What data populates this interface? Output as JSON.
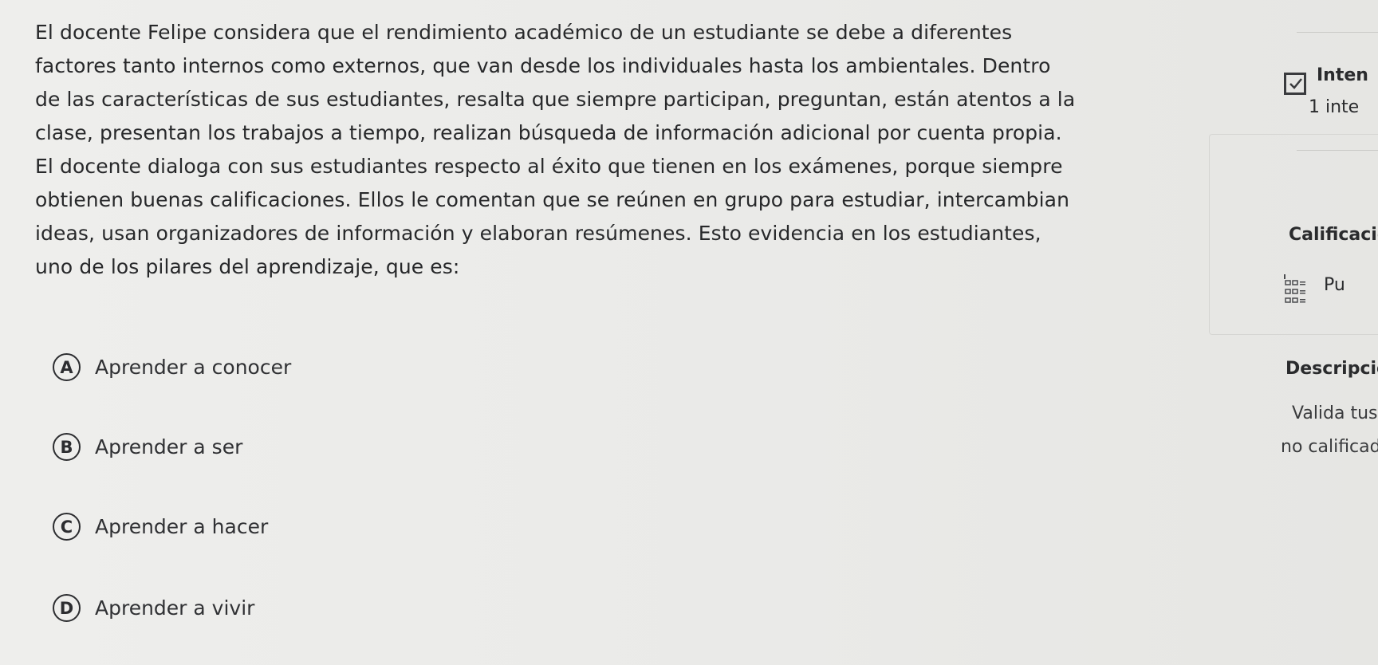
{
  "question": {
    "lines": [
      "El docente Felipe considera que el rendimiento académico de un estudiante se debe a diferentes",
      "factores tanto internos como externos, que van desde los individuales hasta los ambientales. Dentro",
      "de las características de sus estudiantes, resalta que siempre participan, preguntan, están atentos a la",
      "clase, presentan los trabajos a tiempo, realizan búsqueda de información adicional por cuenta propia.",
      "El docente dialoga con sus estudiantes respecto al éxito que tienen en los exámenes, porque siempre",
      "obtienen buenas calificaciones. Ellos le comentan que se reúnen en grupo para estudiar, intercambian",
      "ideas, usan organizadores de información y elaboran resúmenes. Esto evidencia en los estudiantes,",
      "uno de los pilares del aprendizaje, que es:"
    ]
  },
  "options": [
    {
      "letter": "A",
      "label": "Aprender a conocer"
    },
    {
      "letter": "B",
      "label": "Aprender a ser"
    },
    {
      "letter": "C",
      "label": "Aprender a hacer"
    },
    {
      "letter": "D",
      "label": "Aprender a vivir"
    }
  ],
  "side_panel": {
    "attempts_title": "Inten",
    "attempts_count": "1 inte",
    "grading_title": "Calificacio",
    "grading_value": "Pu",
    "description_title": "Descripció",
    "description_line1": "Valida tus c",
    "description_line2": "no calificad",
    "icons": {
      "attempts": "checkbox-check-icon",
      "grading": "grid-list-icon"
    }
  },
  "colors": {
    "background": "#ebebe9",
    "text": "#2a2b2d"
  }
}
